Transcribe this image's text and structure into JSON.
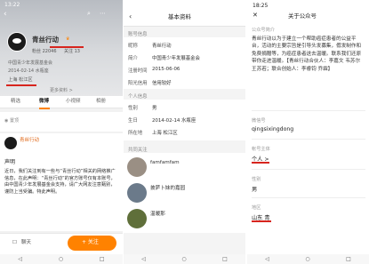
{
  "panel1": {
    "status_time": "13:22",
    "name": "青丝行动",
    "stats": [
      "粉丝 22046",
      "关注 13"
    ],
    "verified_text": "中国青少年发展基金会",
    "signature": "2014-02-14 水瓶座",
    "location": "上海 松江区",
    "more_info": "更多资料 >",
    "tabs": [
      "精选",
      "微博",
      "小视频",
      "相册"
    ],
    "post_meta_author": "青丝行动",
    "post_meta_time": "",
    "post_heading": "声明",
    "post_body": "近日，我们关注到有一些与“青丝行动”相关的网络推广信息，在此声明：“青丝行动”的官方账号仅有本账号，由中国青少年发展基金会支持，请广大网友注意甄别，谨防上当受骗。特此声明。",
    "chat_label": "聊天",
    "follow_label": "+ 关注",
    "nav": [
      "◁",
      "○",
      "□"
    ]
  },
  "panel2": {
    "back_icon": "back-arrow",
    "title": "基本资料",
    "section_basic": "账号信息",
    "rows": [
      {
        "k": "昵称",
        "v": "青丝行动"
      },
      {
        "k": "简介",
        "v": "中国青少年发展基金会"
      },
      {
        "k": "注册时间",
        "v": "2015-06-06"
      },
      {
        "k": "阳光信用",
        "v": "信用较好"
      }
    ],
    "section_personal": "个人信息",
    "personal_rows": [
      {
        "k": "性别",
        "v": "男"
      },
      {
        "k": "生日",
        "v": "2014-02-14 水瓶座"
      },
      {
        "k": "所在地",
        "v": "上海 松江区"
      }
    ],
    "section_friends": "共同关注",
    "friends": [
      {
        "name": "famfamfam",
        "sub": "",
        "color": "#9a8f84"
      },
      {
        "name": "披萨卜妹的嘉园",
        "sub": "",
        "color": "#6b7a8a"
      },
      {
        "name": "温暖那",
        "sub": "",
        "color": "#5f6f3a"
      }
    ],
    "nav": [
      "◁",
      "○",
      "□"
    ]
  },
  "panel3": {
    "status_time": "18:25",
    "title": "关于公众号",
    "section_title": "公众号简介",
    "intro": "青丝行动以为于建立一个帮助癌症患者的公益平台，活动的主要宗旨是引导头发募集，假发制作和免费捐赠等，为癌症患者送去温暖。联系我们还原带你走进温暖。【青丝行动合伙人：李嘉文 韦苏尔 王苏若；联合创始人：李睿钧 乔霖】",
    "wechat_label": "微信号",
    "wechat_value": "qingsixingdong",
    "type_label": "帐号主体",
    "type_value": "个人 >",
    "gender_label": "性别",
    "gender_value": "男",
    "region_label": "地区",
    "region_value": "山东 青",
    "nav": [
      "◁",
      "○",
      "□"
    ]
  },
  "colors": {
    "accent_orange": "#ff8200",
    "highlight_red": "#d7251e",
    "text_dark": "#222222",
    "text_grey": "#888888"
  }
}
